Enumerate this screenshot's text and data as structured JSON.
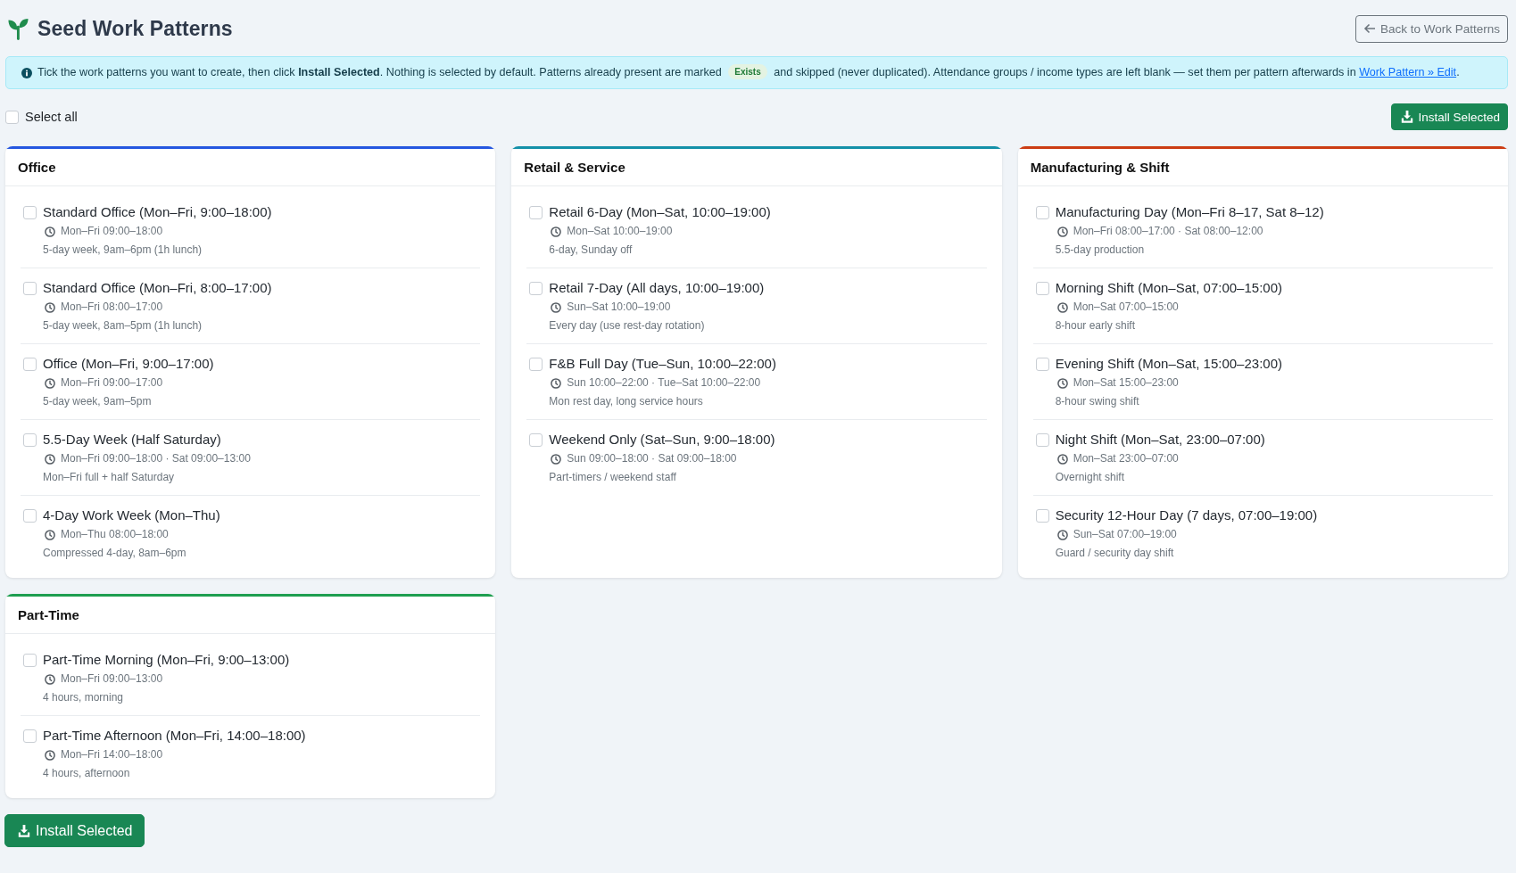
{
  "header": {
    "title": "Seed Work Patterns",
    "back_button": "Back to Work Patterns"
  },
  "info": {
    "text": "Tick the work patterns you want to create, then click **Install Selected**. Nothing is selected by default. Patterns already present are marked",
    "badge": "Exists",
    "text_after": "and skipped (never duplicated). Attendance groups / income types are left blank — set them per pattern afterwards in",
    "link": "Work Pattern » Edit",
    "text_end": "."
  },
  "toolbar": {
    "select_all": {
      "label": "Select all",
      "checked": false
    },
    "install_button": "Install Selected"
  },
  "groups": [
    {
      "title": "Office",
      "color": "#2557e0",
      "patterns": [
        {
          "name": "Standard Office (Mon–Fri, 9:00–18:00)",
          "schedule": "Mon–Fri 09:00–18:00",
          "description": "5-day week, 9am–6pm (1h lunch)",
          "checked": false
        },
        {
          "name": "Standard Office (Mon–Fri, 8:00–17:00)",
          "schedule": "Mon–Fri 08:00–17:00",
          "description": "5-day week, 8am–5pm (1h lunch)",
          "checked": false
        },
        {
          "name": "Office (Mon–Fri, 9:00–17:00)",
          "schedule": "Mon–Fri 09:00–17:00",
          "description": "5-day week, 9am–5pm",
          "checked": false
        },
        {
          "name": "5.5-Day Week (Half Saturday)",
          "schedule": "Mon–Fri 09:00–18:00 · Sat 09:00–13:00",
          "description": "Mon–Fri full + half Saturday",
          "checked": false
        },
        {
          "name": "4-Day Work Week (Mon–Thu)",
          "schedule": "Mon–Thu 08:00–18:00",
          "description": "Compressed 4-day, 8am–6pm",
          "checked": false
        }
      ]
    },
    {
      "title": "Retail & Service",
      "color": "#1490a9",
      "patterns": [
        {
          "name": "Retail 6-Day (Mon–Sat, 10:00–19:00)",
          "schedule": "Mon–Sat 10:00–19:00",
          "description": "6-day, Sunday off",
          "checked": false
        },
        {
          "name": "Retail 7-Day (All days, 10:00–19:00)",
          "schedule": "Sun–Sat 10:00–19:00",
          "description": "Every day (use rest-day rotation)",
          "checked": false
        },
        {
          "name": "F&B Full Day (Tue–Sun, 10:00–22:00)",
          "schedule": "Sun 10:00–22:00 · Tue–Sat 10:00–22:00",
          "description": "Mon rest day, long service hours",
          "checked": false
        },
        {
          "name": "Weekend Only (Sat–Sun, 9:00–18:00)",
          "schedule": "Sun 09:00–18:00 · Sat 09:00–18:00",
          "description": "Part-timers / weekend staff",
          "checked": false
        }
      ]
    },
    {
      "title": "Manufacturing & Shift",
      "color": "#cc3d14",
      "patterns": [
        {
          "name": "Manufacturing Day (Mon–Fri 8–17, Sat 8–12)",
          "schedule": "Mon–Fri 08:00–17:00 · Sat 08:00–12:00",
          "description": "5.5-day production",
          "checked": false
        },
        {
          "name": "Morning Shift (Mon–Sat, 07:00–15:00)",
          "schedule": "Mon–Sat 07:00–15:00",
          "description": "8-hour early shift",
          "checked": false
        },
        {
          "name": "Evening Shift (Mon–Sat, 15:00–23:00)",
          "schedule": "Mon–Sat 15:00–23:00",
          "description": "8-hour swing shift",
          "checked": false
        },
        {
          "name": "Night Shift (Mon–Sat, 23:00–07:00)",
          "schedule": "Mon–Sat 23:00–07:00",
          "description": "Overnight shift",
          "checked": false
        },
        {
          "name": "Security 12-Hour Day (7 days, 07:00–19:00)",
          "schedule": "Sun–Sat 07:00–19:00",
          "description": "Guard / security day shift",
          "checked": false
        }
      ]
    },
    {
      "title": "Part-Time",
      "color": "#1e9e50",
      "patterns": [
        {
          "name": "Part-Time Morning (Mon–Fri, 9:00–13:00)",
          "schedule": "Mon–Fri 09:00–13:00",
          "description": "4 hours, morning",
          "checked": false
        },
        {
          "name": "Part-Time Afternoon (Mon–Fri, 14:00–18:00)",
          "schedule": "Mon–Fri 14:00–18:00",
          "description": "4 hours, afternoon",
          "checked": false
        }
      ]
    }
  ],
  "footer": {
    "install_button": "Install Selected"
  }
}
